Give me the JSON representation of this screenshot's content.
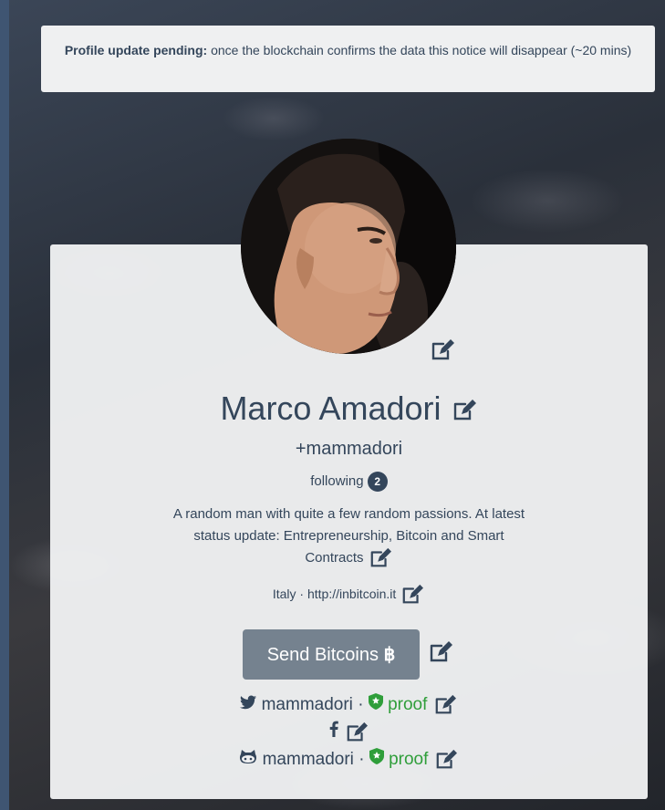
{
  "notice": {
    "bold": "Profile update pending:",
    "text": "once the blockchain confirms the data this notice will disappear (~20 mins)"
  },
  "profile": {
    "name": "Marco Amadori",
    "handle": "+mammadori",
    "following_label": "following",
    "following_count": "2",
    "bio": "A random man with quite a few random passions. At latest status update: Entrepreneurship, Bitcoin and Smart Contracts",
    "location": "Italy",
    "separator": "·",
    "website": "http://inbitcoin.it",
    "send_button": "Send Bitcoins"
  },
  "accounts": [
    {
      "service": "twitter",
      "icon": "twitter-icon",
      "username": "mammadori",
      "proof": "proof"
    },
    {
      "service": "facebook",
      "icon": "facebook-icon",
      "username": "",
      "proof": ""
    },
    {
      "service": "github",
      "icon": "github-icon",
      "username": "mammadori",
      "proof": "proof"
    }
  ],
  "colors": {
    "text": "#34465b",
    "proof": "#2f9e3a",
    "button": "#75828f",
    "card": "#f0f1f2"
  }
}
